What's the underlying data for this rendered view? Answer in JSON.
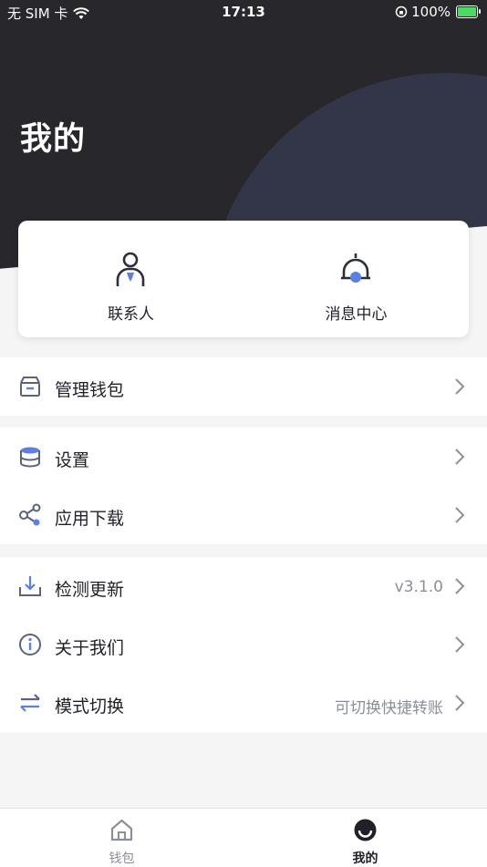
{
  "status_bar": {
    "carrier": "无 SIM 卡",
    "time": "17:13",
    "battery": "100%"
  },
  "header": {
    "title": "我的"
  },
  "quick_actions": [
    {
      "label": "联系人",
      "icon": "contact-icon"
    },
    {
      "label": "消息中心",
      "icon": "bell-icon"
    }
  ],
  "sections": [
    {
      "rows": [
        {
          "label": "管理钱包",
          "icon": "wallet-box-icon",
          "value": ""
        }
      ]
    },
    {
      "rows": [
        {
          "label": "设置",
          "icon": "database-settings-icon",
          "value": ""
        },
        {
          "label": "应用下载",
          "icon": "share-nodes-icon",
          "value": ""
        }
      ]
    },
    {
      "rows": [
        {
          "label": "检测更新",
          "icon": "download-icon",
          "value": "v3.1.0"
        },
        {
          "label": "关于我们",
          "icon": "info-icon",
          "value": ""
        },
        {
          "label": "模式切换",
          "icon": "swap-arrows-icon",
          "value": "可切换快捷转账"
        }
      ]
    }
  ],
  "tabbar": {
    "tabs": [
      {
        "label": "钱包",
        "icon": "home-icon",
        "active": false
      },
      {
        "label": "我的",
        "icon": "profile-face-icon",
        "active": true
      }
    ]
  },
  "colors": {
    "header_bg": "#27272c",
    "header_circle": "#333548",
    "accent_blue": "#5b7fe8",
    "icon_gray": "#5c6377",
    "text_primary": "#1f2029",
    "text_secondary": "#8c8f99",
    "tab_inactive": "#8c8f99"
  }
}
